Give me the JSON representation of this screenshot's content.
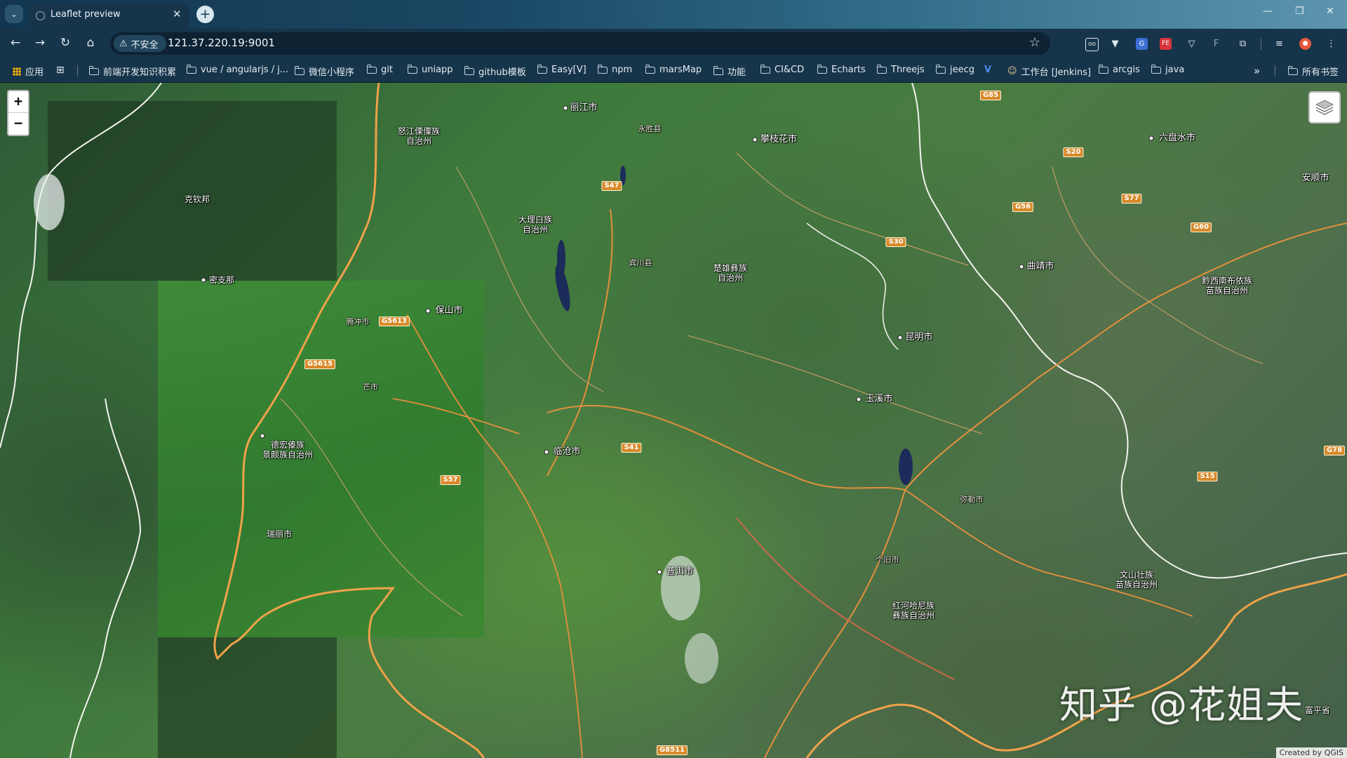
{
  "browser": {
    "tab_title": "Leaflet preview",
    "new_tab_symbol": "+",
    "window": {
      "minimize": "—",
      "restore": "❐",
      "close": "✕"
    },
    "insecure_label": "不安全",
    "url": "121.37.220.19:9001"
  },
  "bookmarks": [
    {
      "label": "应用",
      "type": "apps"
    },
    {
      "label": "前端开发知识积累",
      "type": "folder"
    },
    {
      "label": "vue / angularjs / j...",
      "type": "folder"
    },
    {
      "label": "微信小程序",
      "type": "folder"
    },
    {
      "label": "git",
      "type": "folder"
    },
    {
      "label": "uniapp",
      "type": "folder"
    },
    {
      "label": "github模板",
      "type": "folder"
    },
    {
      "label": "Easy[V]",
      "type": "folder"
    },
    {
      "label": "npm",
      "type": "folder"
    },
    {
      "label": "marsMap",
      "type": "folder"
    },
    {
      "label": "功能",
      "type": "folder"
    },
    {
      "label": "CI&CD",
      "type": "folder"
    },
    {
      "label": "Echarts",
      "type": "folder"
    },
    {
      "label": "Threejs",
      "type": "folder"
    },
    {
      "label": "jeecg",
      "type": "folder"
    },
    {
      "label": "工作台 [Jenkins]",
      "type": "link"
    },
    {
      "label": "arcgis",
      "type": "folder"
    },
    {
      "label": "java",
      "type": "folder"
    },
    {
      "label": "所有书签",
      "type": "folder"
    }
  ],
  "map": {
    "zoom_in": "+",
    "zoom_out": "−",
    "places": [
      {
        "name": "丽江市",
        "kind": "city"
      },
      {
        "name": "攀枝花市",
        "kind": "city"
      },
      {
        "name": "六盘水市",
        "kind": "city"
      },
      {
        "name": "安顺市",
        "kind": "city"
      },
      {
        "name": "怒江傈僳族\n自治州",
        "kind": "region"
      },
      {
        "name": "克钦邦",
        "kind": "region"
      },
      {
        "name": "大理白族\n自治州",
        "kind": "region"
      },
      {
        "name": "密支那",
        "kind": "city"
      },
      {
        "name": "楚雄彝族\n自治州",
        "kind": "region"
      },
      {
        "name": "曲靖市",
        "kind": "city"
      },
      {
        "name": "黔西南布依族\n苗族自治州",
        "kind": "region"
      },
      {
        "name": "保山市",
        "kind": "city"
      },
      {
        "name": "昆明市",
        "kind": "city"
      },
      {
        "name": "德宏傣族\n景颇族自治州",
        "kind": "region"
      },
      {
        "name": "玉溪市",
        "kind": "city"
      },
      {
        "name": "瑞丽市",
        "kind": "city"
      },
      {
        "name": "临沧市",
        "kind": "city"
      },
      {
        "name": "文山壮族\n苗族自治州",
        "kind": "region"
      },
      {
        "name": "红河哈尼族\n彝族自治州",
        "kind": "region"
      },
      {
        "name": "普洱市",
        "kind": "city"
      },
      {
        "name": "富平省",
        "kind": "region"
      },
      {
        "name": "腾冲市",
        "kind": "small"
      },
      {
        "name": "芒市",
        "kind": "small"
      },
      {
        "name": "永胜县",
        "kind": "small"
      },
      {
        "name": "宾川县",
        "kind": "small"
      },
      {
        "name": "弥勒市",
        "kind": "small"
      },
      {
        "name": "个旧市",
        "kind": "small"
      }
    ],
    "roads": [
      "G85",
      "S20",
      "S47",
      "G56",
      "S77",
      "G60",
      "S30",
      "G5613",
      "G5615",
      "S41",
      "S57",
      "G78",
      "S15",
      "G8511"
    ],
    "watermark": "知乎 @花姐夫",
    "attribution": "Created by QGIS"
  }
}
